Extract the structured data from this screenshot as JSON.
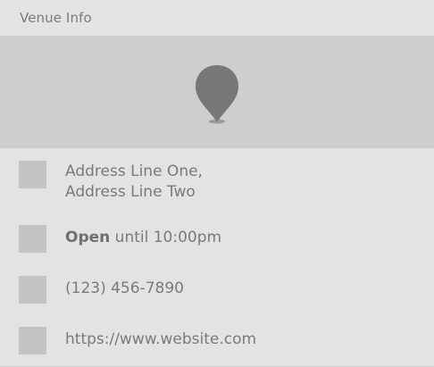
{
  "header": {
    "title": "Venue Info"
  },
  "map": {
    "icon": "map-pin-icon"
  },
  "details": {
    "address": {
      "icon": "address-icon",
      "line1": "Address Line One,",
      "line2": "Address Line Two"
    },
    "hours": {
      "icon": "clock-icon",
      "status": "Open",
      "text": "until 10:00pm"
    },
    "phone": {
      "icon": "phone-icon",
      "text": "(123) 456-7890"
    },
    "website": {
      "icon": "globe-icon",
      "text": "https://www.website.com"
    }
  },
  "colors": {
    "background": "#e3e3e3",
    "map_background": "#cecece",
    "pin": "#777777",
    "placeholder_icon": "#c3c3c3",
    "text": "#7a7a7a"
  }
}
